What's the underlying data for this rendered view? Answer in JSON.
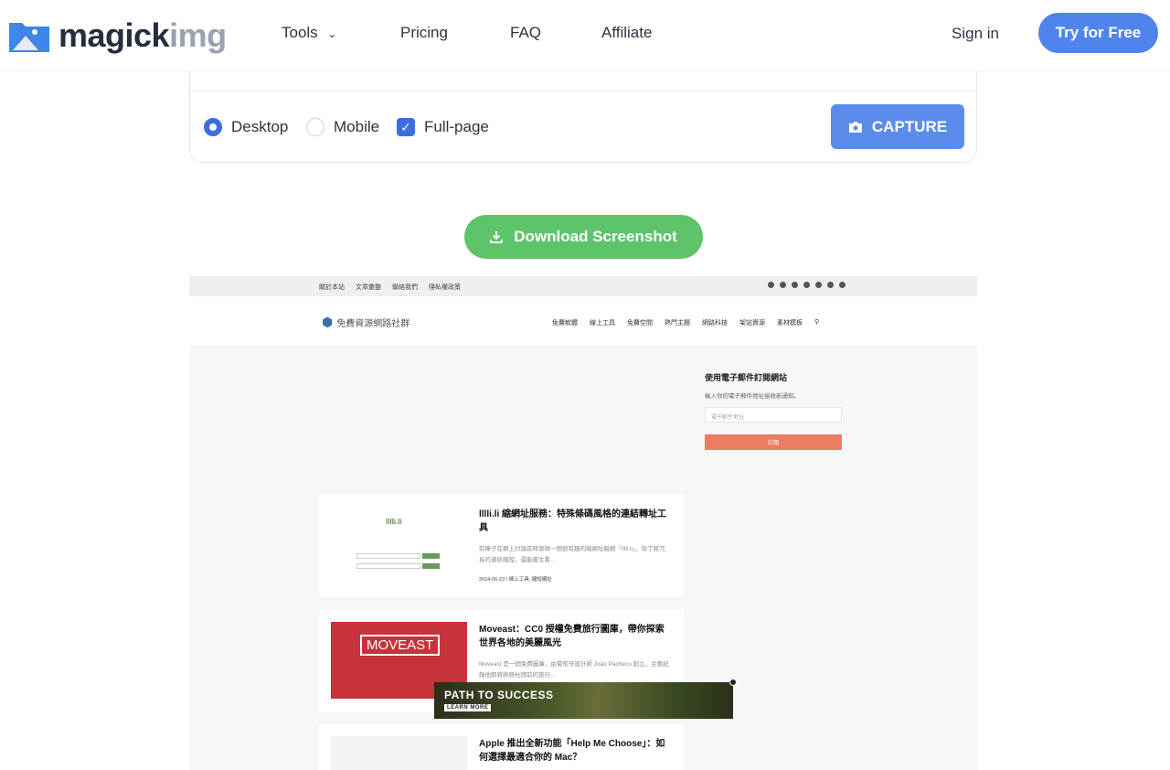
{
  "nav": {
    "brand_main": "magick",
    "brand_accent": "img",
    "links": [
      "Tools",
      "Pricing",
      "FAQ",
      "Affiliate"
    ],
    "sign_in": "Sign in",
    "try": "Try for Free"
  },
  "options": {
    "desktop": "Desktop",
    "mobile": "Mobile",
    "fullpage": "Full-page",
    "selected": "Desktop",
    "fullpage_checked": true,
    "capture": "CAPTURE"
  },
  "download": "Download Screenshot",
  "preview": {
    "top_links": [
      "關於本站",
      "文章彙整",
      "聯絡我們",
      "隱私權政策"
    ],
    "logo": "免費資源網路社群",
    "menu": [
      "免費軟體",
      "線上工具",
      "免費空間",
      "熱門主題",
      "網路科技",
      "架站資源",
      "素材模板"
    ],
    "sidebar": {
      "title": "使用電子郵件訂閱網站",
      "desc": "輸入你的電子郵件地址接收新通知。",
      "placeholder": "電子郵件地址",
      "button": "訂閱"
    },
    "articles": [
      {
        "title": "lllli.li 縮網址服務：特殊條碼風格的連結轉址工具",
        "excerpt": "前陣子在網上討論區時發現一個很有趣的縮網址服務「lllli.li」，除了將冗長的連結縮短，還能產生看…",
        "meta": "2024-06-23 / 線上工具, 縮短網址",
        "thumb_text": "lllli.li"
      },
      {
        "title": "Moveast：CC0 授權免費旅行圖庫，帶你探索世界各地的美麗風光",
        "excerpt": "Moveast 是一個免費圖庫，由葡萄牙設計師 João Pacheco 創立，主要紀錄他即將移居杜拜前的旅行…",
        "thumb_text": "MOVEAST"
      },
      {
        "title": "Apple 推出全新功能「Help Me Choose」：如何選擇最適合你的 Mac？"
      }
    ],
    "ad": {
      "title": "PATH TO SUCCESS",
      "cta": "LEARN MORE"
    }
  },
  "colors": {
    "primary": "#4f84ec",
    "download": "#5ec46a",
    "subscribe": "#ec7c63",
    "moveast": "#c8323c"
  }
}
